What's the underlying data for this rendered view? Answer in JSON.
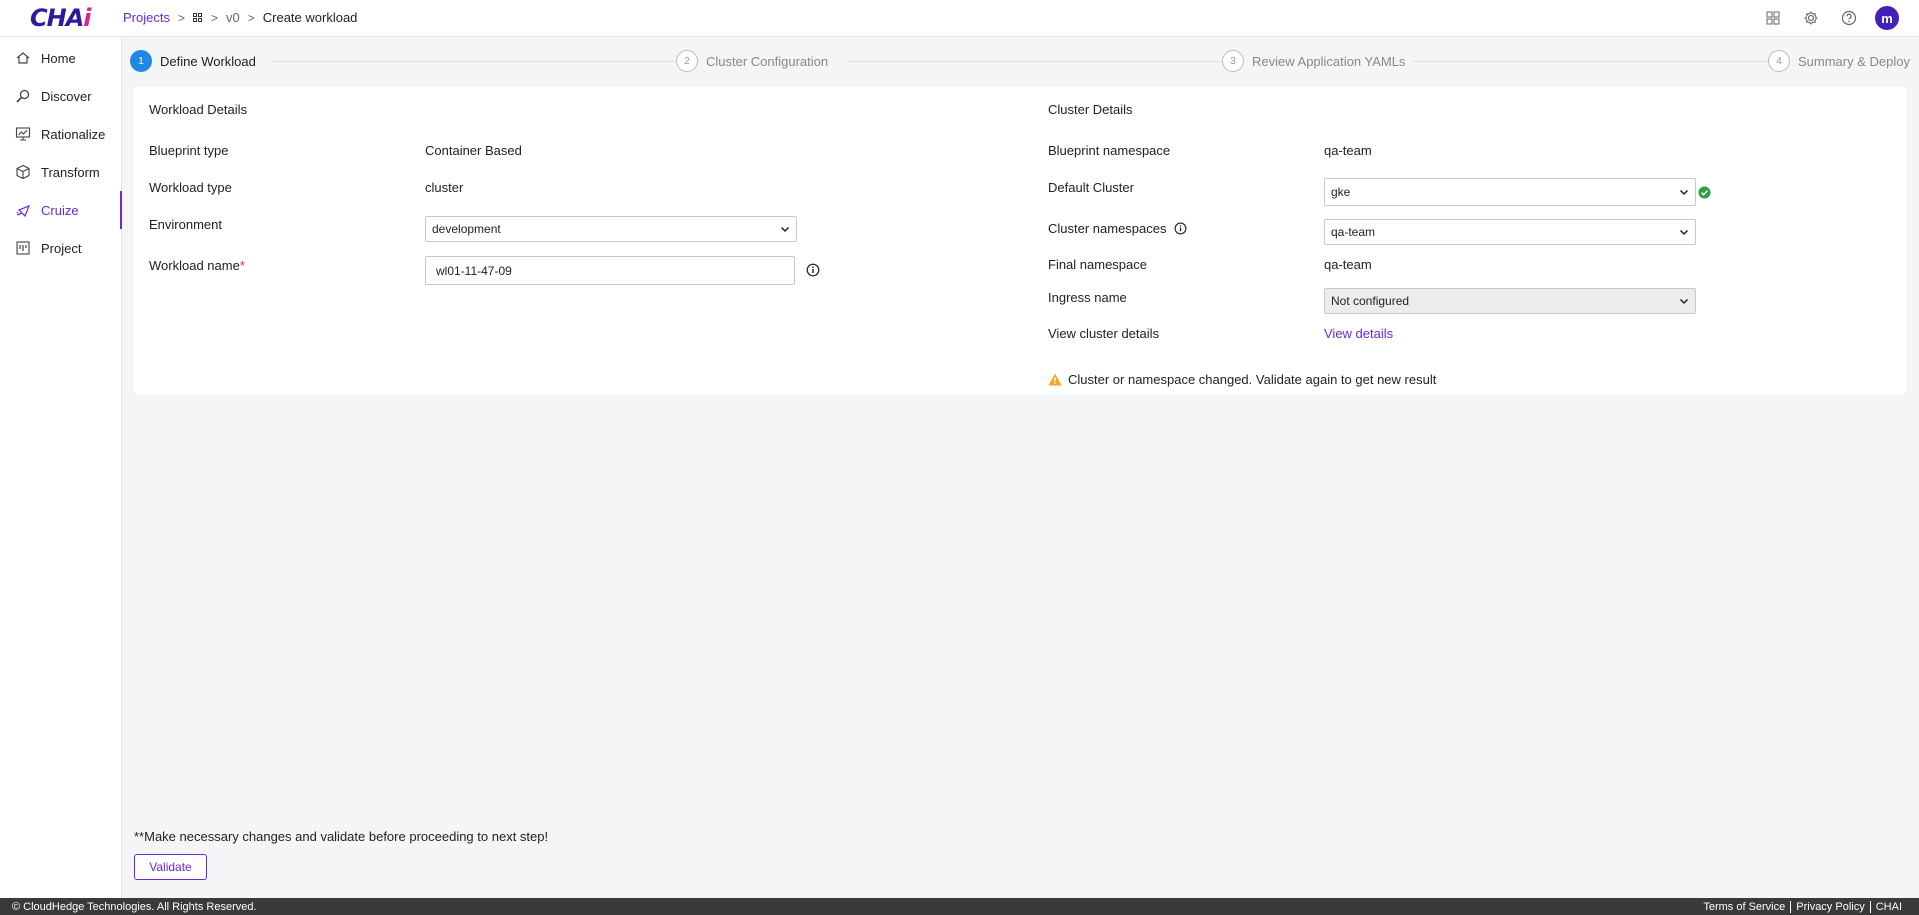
{
  "logo": {
    "text_main": "CHA",
    "text_accent": "i"
  },
  "breadcrumb": {
    "projects": "Projects",
    "version": "v0",
    "current": "Create workload"
  },
  "sidebar": {
    "items": [
      {
        "label": "Home",
        "icon": "home-icon"
      },
      {
        "label": "Discover",
        "icon": "discover-icon"
      },
      {
        "label": "Rationalize",
        "icon": "rationalize-icon"
      },
      {
        "label": "Transform",
        "icon": "transform-icon"
      },
      {
        "label": "Cruize",
        "icon": "cruize-icon",
        "active": true
      },
      {
        "label": "Project",
        "icon": "project-icon"
      }
    ]
  },
  "steps": [
    {
      "num": "1",
      "label": "Define Workload",
      "active": true
    },
    {
      "num": "2",
      "label": "Cluster Configuration"
    },
    {
      "num": "3",
      "label": "Review Application YAMLs"
    },
    {
      "num": "4",
      "label": "Summary & Deploy"
    }
  ],
  "workload": {
    "title": "Workload Details",
    "blueprint_type_label": "Blueprint type",
    "blueprint_type_value": "Container Based",
    "workload_type_label": "Workload type",
    "workload_type_value": "cluster",
    "environment_label": "Environment",
    "environment_value": "development",
    "workload_name_label": "Workload name",
    "workload_name_required": "*",
    "workload_name_value": "wl01-11-47-09"
  },
  "cluster": {
    "title": "Cluster Details",
    "blueprint_namespace_label": "Blueprint namespace",
    "blueprint_namespace_value": "qa-team",
    "default_cluster_label": "Default Cluster",
    "default_cluster_value": "gke",
    "cluster_namespaces_label": "Cluster namespaces",
    "cluster_namespaces_value": "qa-team",
    "final_namespace_label": "Final namespace",
    "final_namespace_value": "qa-team",
    "ingress_label": "Ingress name",
    "ingress_value": "Not configured",
    "view_cluster_label": "View cluster details",
    "view_details_link": "View details",
    "warning": "Cluster or namespace changed. Validate again to get new result"
  },
  "bottom": {
    "note": "**Make necessary changes and validate before proceeding to next step!",
    "validate_label": "Validate"
  },
  "footer": {
    "copyright": "© CloudHedge Technologies. All Rights Reserved.",
    "terms": "Terms of Service",
    "privacy": "Privacy Policy",
    "brand": "CHAI"
  },
  "colors": {
    "accent": "#6d28d9",
    "step_active": "#1e88e5",
    "success": "#2e9d46",
    "warning": "#f5a623"
  }
}
